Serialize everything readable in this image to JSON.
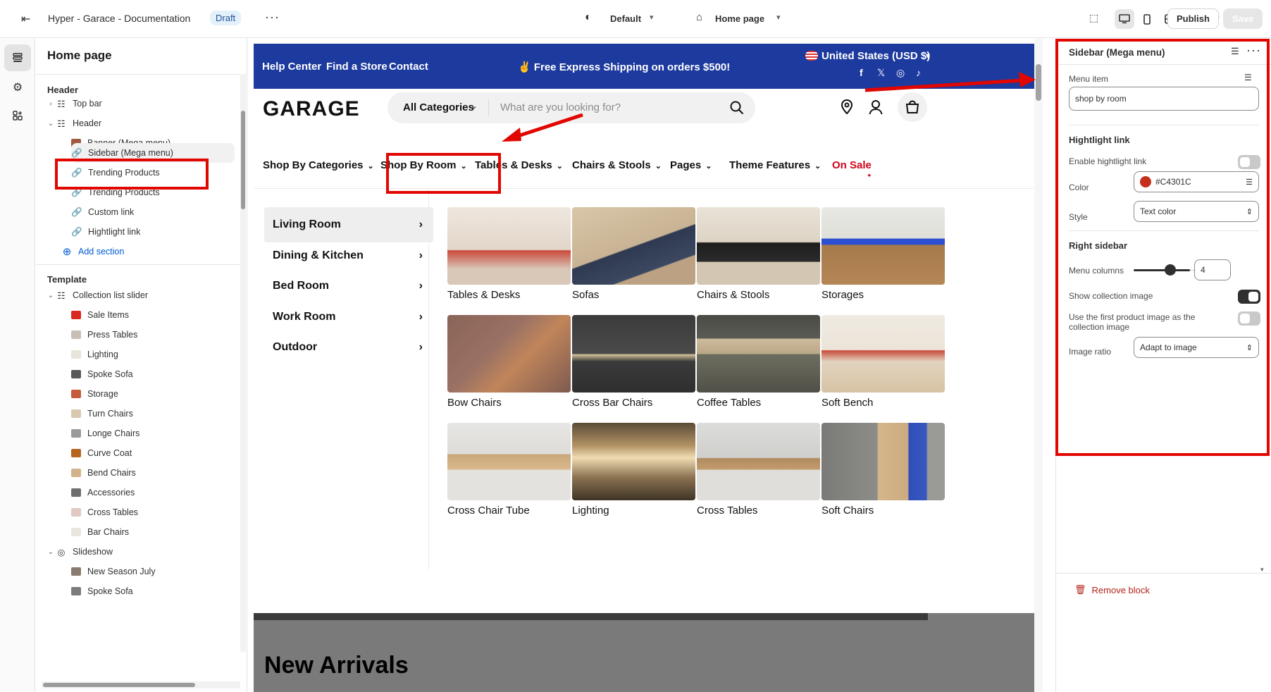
{
  "topbar": {
    "title": "Hyper - Garace - Documentation",
    "badge": "Draft",
    "theme_select": "Default",
    "page_select": "Home page",
    "publish": "Publish",
    "save": "Save"
  },
  "left": {
    "title": "Home page",
    "header_section": "Header",
    "template_section": "Template",
    "header_items": [
      {
        "label": "Top bar"
      },
      {
        "label": "Header"
      },
      {
        "label": "Banner (Mega menu)"
      },
      {
        "label": "Sidebar (Mega menu)"
      },
      {
        "label": "Trending Products"
      },
      {
        "label": "Trending Products"
      },
      {
        "label": "Custom link"
      },
      {
        "label": "Hightlight link"
      },
      {
        "label": "Add section"
      }
    ],
    "template_items": [
      {
        "label": "Collection list slider"
      },
      {
        "label": "Sale Items"
      },
      {
        "label": "Press Tables"
      },
      {
        "label": "Lighting"
      },
      {
        "label": "Spoke Sofa"
      },
      {
        "label": "Storage"
      },
      {
        "label": "Turn Chairs"
      },
      {
        "label": "Longe Chairs"
      },
      {
        "label": "Curve Coat"
      },
      {
        "label": "Bend Chairs"
      },
      {
        "label": "Accessories"
      },
      {
        "label": "Cross Tables"
      },
      {
        "label": "Bar Chairs"
      },
      {
        "label": "Slideshow"
      },
      {
        "label": "New Season July"
      },
      {
        "label": "Spoke Sofa"
      }
    ]
  },
  "store": {
    "announce_links": [
      "Help Center",
      "Find a Store",
      "Contact"
    ],
    "announce_text": "✌ Free Express Shipping on orders $500!",
    "currency": "United States (USD $)",
    "logo": "GARAGE",
    "categories_select": "All Categories",
    "search_placeholder": "What are you looking for?",
    "nav": [
      "Shop By Categories",
      "Shop By Room",
      "Tables & Desks",
      "Chairs & Stools",
      "Pages",
      "Theme Features",
      "On Sale"
    ],
    "rooms": [
      "Living Room",
      "Dining & Kitchen",
      "Bed Room",
      "Work Room",
      "Outdoor"
    ],
    "collections": [
      "Tables & Desks",
      "Sofas",
      "Chairs & Stools",
      "Storages",
      "Bow Chairs",
      "Cross Bar Chairs",
      "Coffee Tables",
      "Soft Bench",
      "Cross Chair Tube",
      "Lighting",
      "Cross Tables",
      "Soft Chairs"
    ],
    "new_arrivals": "New Arrivals"
  },
  "right": {
    "title": "Sidebar (Mega menu)",
    "menu_item_label": "Menu item",
    "menu_item_value": "shop by room",
    "highlight_heading": "Hightlight link",
    "enable_highlight": "Enable hightlight link",
    "color_label": "Color",
    "color_value": "#C4301C",
    "style_label": "Style",
    "style_value": "Text color",
    "right_sidebar_heading": "Right sidebar",
    "menu_columns_label": "Menu columns",
    "menu_columns_value": "4",
    "show_collection_image": "Show collection image",
    "first_product_image": "Use the first product image as the collection image",
    "image_ratio_label": "Image ratio",
    "image_ratio_value": "Adapt to image",
    "remove_block": "Remove block"
  },
  "colors": {
    "announce_bg": "#1d3a9e",
    "accent_red": "#e10600",
    "sale_red": "#d0021b",
    "swatch": "#C4301C"
  }
}
